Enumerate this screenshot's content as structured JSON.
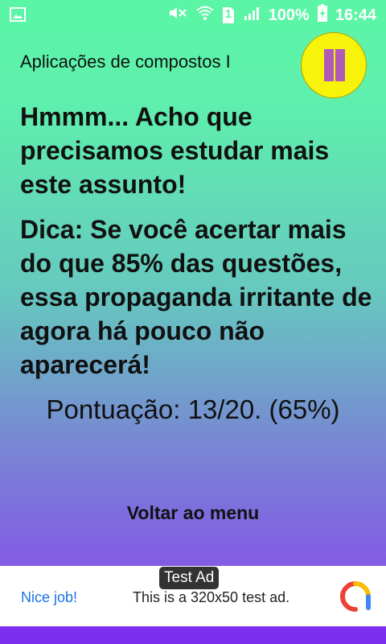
{
  "status_bar": {
    "battery": "100%",
    "sim_slot": "1",
    "time": "16:44"
  },
  "topic": "Aplicações de compostos I",
  "messages": {
    "result": "Hmmm... Acho que precisamos estudar mais este assunto!",
    "tip": "Dica: Se você acertar mais do que 85% das questões, essa propaganda irritante de agora há pouco não aparecerá!"
  },
  "score": "Pontuação: 13/20. (65%)",
  "back_button": "Voltar ao menu",
  "ad": {
    "tag": "Test Ad",
    "left_text": "Nice job!",
    "body_text": "This is a 320x50 test ad."
  },
  "colors": {
    "status_bar": "#5af5a5",
    "pause_button": "#f7f30a",
    "pause_bars": "#b15bb8",
    "gradient_top": "#5cf5a6",
    "gradient_bottom": "#8a3ff0",
    "ad_link": "#1a73e8"
  },
  "icons": [
    "image-icon",
    "mute-icon",
    "wifi-icon",
    "sim-icon",
    "signal-icon",
    "battery-icon",
    "pause-icon",
    "ad-logo-icon"
  ]
}
